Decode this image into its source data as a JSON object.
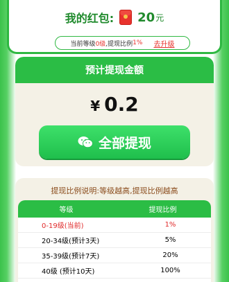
{
  "wallet": {
    "label": "我的红包:",
    "amount": "20",
    "unit": "元",
    "level_prefix": "当前等级",
    "level_value": "0级",
    "level_mid": ",提现比例",
    "ratio_value": "1%",
    "upgrade_label": "去升级"
  },
  "withdraw": {
    "header": "预计提现金额",
    "currency": "¥",
    "amount": "0.2",
    "button_label": "全部提现"
  },
  "ratio": {
    "description": "提现比例说明:等级越高,提现比例越高",
    "columns": [
      "等级",
      "提现比例"
    ],
    "rows": [
      {
        "level": "0-19级(当前)",
        "ratio": "1%"
      },
      {
        "level": "20-34级(预计3天)",
        "ratio": "5%"
      },
      {
        "level": "35-39级(预计7天)",
        "ratio": "20%"
      },
      {
        "level": "40级 (预计10天)",
        "ratio": "100%"
      }
    ]
  },
  "colors": {
    "brand_green": "#2bbd45",
    "accent_red": "#e8322d",
    "panel_bg": "#f4f1e6"
  }
}
